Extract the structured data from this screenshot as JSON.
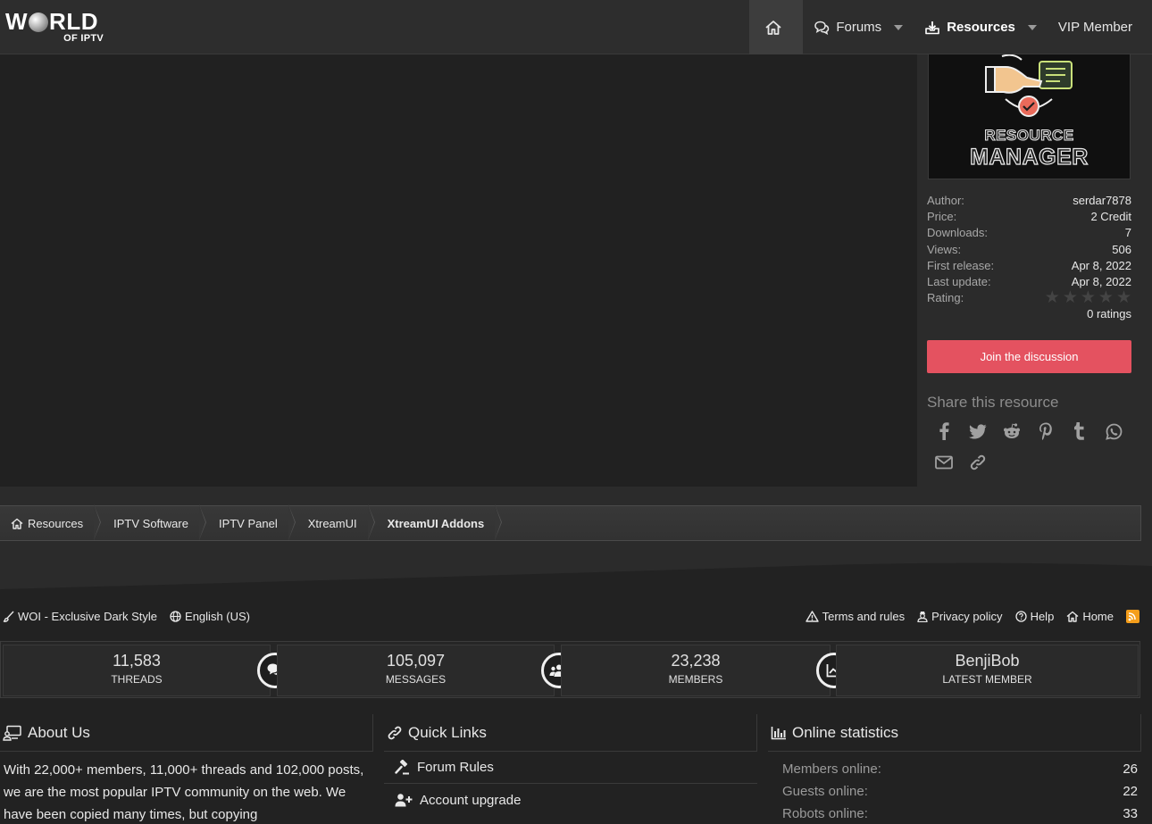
{
  "header": {
    "logo_line1": "W",
    "logo_line1b": "RLD",
    "logo_line2": "OF IPTV",
    "nav": [
      {
        "label": "Forums"
      },
      {
        "label": "Resources"
      },
      {
        "label": "VIP Member"
      }
    ]
  },
  "sidebar": {
    "image_text1": "RESOURCE",
    "image_text2": "MANAGER",
    "info": [
      {
        "key": "Author:",
        "value": "serdar7878"
      },
      {
        "key": "Price:",
        "value": "2 Credit"
      },
      {
        "key": "Downloads:",
        "value": "7"
      },
      {
        "key": "Views:",
        "value": "506"
      },
      {
        "key": "First release:",
        "value": "Apr 8, 2022"
      },
      {
        "key": "Last update:",
        "value": "Apr 8, 2022"
      },
      {
        "key": "Rating:",
        "value": ""
      }
    ],
    "rating_stars": 0,
    "ratings_count": "0 ratings",
    "join_button": "Join the discussion",
    "share_title": "Share this resource",
    "share_icons": [
      "facebook-icon",
      "twitter-icon",
      "reddit-icon",
      "pinterest-icon",
      "tumblr-icon",
      "whatsapp-icon",
      "email-icon",
      "link-icon"
    ]
  },
  "breadcrumb": [
    "Resources",
    "IPTV Software",
    "IPTV Panel",
    "XtreamUI",
    "XtreamUI Addons"
  ],
  "footer": {
    "style_label": "WOI - Exclusive Dark Style",
    "language_label": "English (US)",
    "links": [
      "Terms and rules",
      "Privacy policy",
      "Help",
      "Home"
    ],
    "stats": [
      {
        "num": "11,583",
        "label": "THREADS"
      },
      {
        "num": "105,097",
        "label": "MESSAGES"
      },
      {
        "num": "23,238",
        "label": "MEMBERS"
      },
      {
        "num": "BenjiBob",
        "label": "LATEST MEMBER"
      }
    ],
    "about": {
      "title": "About Us",
      "text": "With 22,000+ members, 11,000+ threads and 102,000 posts, we are the most popular IPTV community on the web. We have been copied many times, but copying"
    },
    "quick_links": {
      "title": "Quick Links",
      "items": [
        "Forum Rules",
        "Account upgrade"
      ]
    },
    "online": {
      "title": "Online statistics",
      "rows": [
        {
          "key": "Members online:",
          "value": "26"
        },
        {
          "key": "Guests online:",
          "value": "22"
        },
        {
          "key": "Robots online:",
          "value": "33"
        }
      ]
    }
  },
  "colors": {
    "accent_button": "#e45260",
    "rss": "#f59e1b"
  }
}
